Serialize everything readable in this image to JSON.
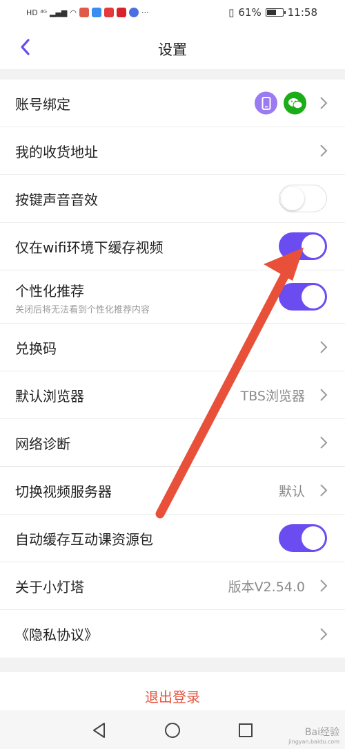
{
  "status_bar": {
    "left_text": "HD ⁴ᴳ",
    "battery_text": "61%",
    "time": "11:58",
    "battery_level": 0.61
  },
  "header": {
    "title": "设置"
  },
  "settings": [
    {
      "label": "账号绑定",
      "type": "bindings"
    },
    {
      "label": "我的收货地址",
      "type": "link"
    },
    {
      "label": "按键声音音效",
      "type": "toggle",
      "on": false
    },
    {
      "label": "仅在wifi环境下缓存视频",
      "type": "toggle",
      "on": true
    },
    {
      "label": "个性化推荐",
      "sub": "关闭后将无法看到个性化推荐内容",
      "type": "toggle",
      "on": true
    },
    {
      "label": "兑换码",
      "type": "link"
    },
    {
      "label": "默认浏览器",
      "value": "TBS浏览器",
      "type": "link"
    },
    {
      "label": "网络诊断",
      "type": "link"
    },
    {
      "label": "切换视频服务器",
      "value": "默认",
      "type": "link"
    },
    {
      "label": "自动缓存互动课资源包",
      "type": "toggle",
      "on": true
    },
    {
      "label": "关于小灯塔",
      "value": "版本V2.54.0",
      "type": "link"
    },
    {
      "label": "《隐私协议》",
      "type": "link"
    }
  ],
  "logout_label": "退出登录",
  "watermark": {
    "text": "Bai经验",
    "sub": "jingyan.baidu.com"
  },
  "colors": {
    "accent": "#6b4cf0",
    "logout": "#e8533f",
    "wechat": "#1aad19",
    "phone_badge": "#9b7bf2",
    "annotation_arrow": "#e8503a"
  },
  "icons": [
    "back-arrow-icon",
    "phone-icon",
    "wechat-icon",
    "chevron-right-icon",
    "nav-back-icon",
    "nav-home-icon",
    "nav-recents-icon"
  ]
}
